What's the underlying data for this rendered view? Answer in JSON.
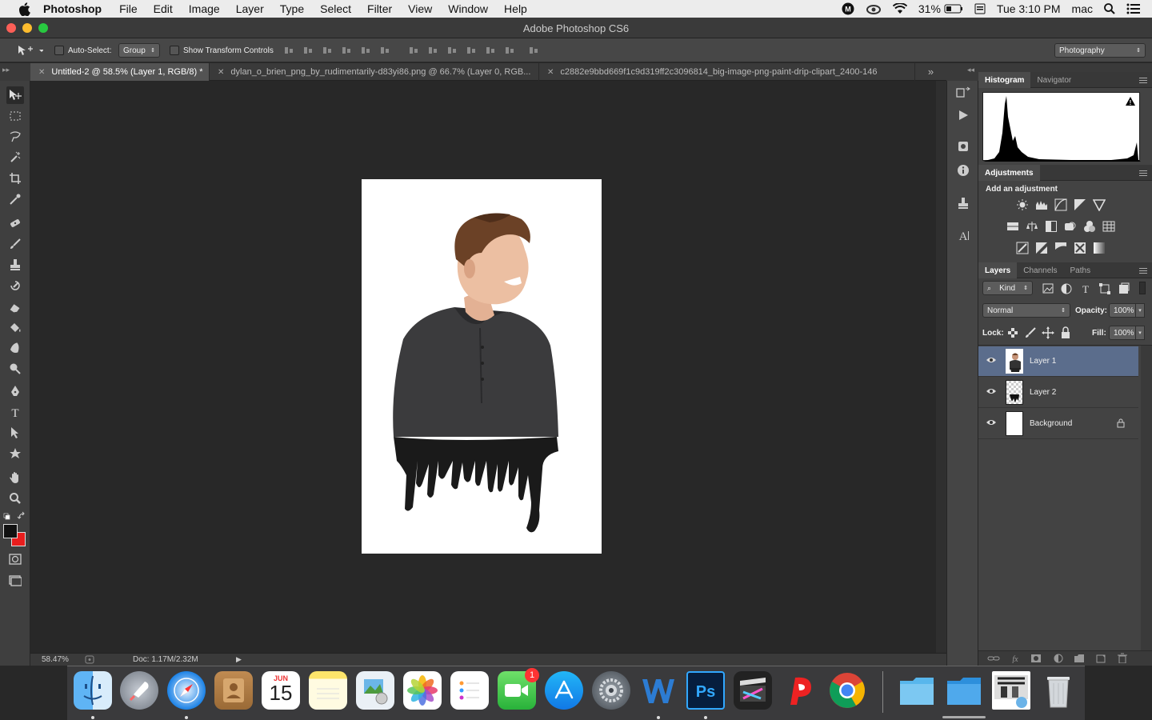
{
  "menubar": {
    "app_name": "Photoshop",
    "items": [
      "File",
      "Edit",
      "Image",
      "Layer",
      "Type",
      "Select",
      "Filter",
      "View",
      "Window",
      "Help"
    ],
    "battery": "31%",
    "clock": "Tue 3:10 PM",
    "user": "mac"
  },
  "window": {
    "title": "Adobe Photoshop CS6"
  },
  "options_bar": {
    "auto_select_label": "Auto-Select:",
    "auto_select_value": "Group",
    "transform_controls_label": "Show Transform Controls",
    "workspace": "Photography"
  },
  "tabs": [
    {
      "label": "Untitled-2 @ 58.5% (Layer 1, RGB/8) *",
      "active": true
    },
    {
      "label": "dylan_o_brien_png_by_rudimentarily-d83yi86.png @ 66.7% (Layer 0, RGB...",
      "active": false
    },
    {
      "label": "c2882e9bbd669f1c9d319ff2c3096814_big-image-png-paint-drip-clipart_2400-146",
      "active": false
    }
  ],
  "tabs_overflow": "»",
  "status": {
    "zoom": "58.47%",
    "doc_size": "Doc: 1.17M/2.32M"
  },
  "histogram_panel": {
    "tabs": [
      "Histogram",
      "Navigator"
    ],
    "warning": "!"
  },
  "adjustments_panel": {
    "tab": "Adjustments",
    "heading": "Add an adjustment"
  },
  "layers_panel": {
    "tabs": [
      "Layers",
      "Channels",
      "Paths"
    ],
    "filter_kind": "Kind",
    "blend_mode": "Normal",
    "opacity_label": "Opacity:",
    "opacity_value": "100%",
    "lock_label": "Lock:",
    "fill_label": "Fill:",
    "fill_value": "100%",
    "layers": [
      {
        "name": "Layer 1",
        "selected": true
      },
      {
        "name": "Layer 2",
        "selected": false
      },
      {
        "name": "Background",
        "selected": false
      }
    ]
  },
  "dock": {
    "calendar_month": "JUN",
    "calendar_day": "15",
    "facetime_badge": "1"
  },
  "colors": {
    "foreground": "#111111",
    "background": "#e81d1d",
    "selected_layer": "#5b6d8c"
  }
}
